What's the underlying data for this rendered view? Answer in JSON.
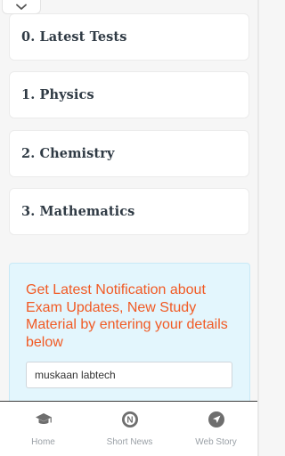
{
  "subjects": [
    {
      "label": "0. Latest Tests"
    },
    {
      "label": "1. Physics"
    },
    {
      "label": "2. Chemistry"
    },
    {
      "label": "3. Mathematics"
    }
  ],
  "notification": {
    "text": "Get Latest Notification about Exam Updates, New Study Material by entering your details below",
    "input_value": "muskaan labtech"
  },
  "bottom_nav": {
    "items": [
      {
        "label": "Home",
        "icon": "graduation-cap-icon"
      },
      {
        "label": "Short News",
        "icon": "news-n-icon"
      },
      {
        "label": "Web Story",
        "icon": "navigation-arrow-icon"
      }
    ]
  },
  "colors": {
    "accent_orange": "#f15a24",
    "notify_bg": "#e3f6fd",
    "icon_gray": "#6e6e6e"
  }
}
